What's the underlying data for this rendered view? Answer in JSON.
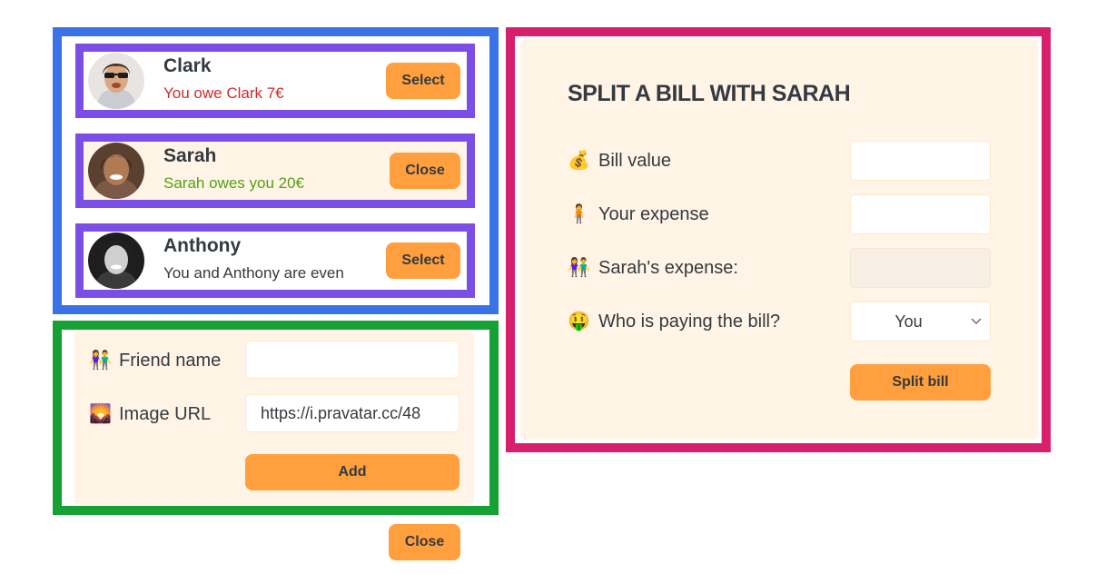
{
  "friends": [
    {
      "name": "Clark",
      "status": "You owe Clark 7€",
      "status_type": "red",
      "button": "Select"
    },
    {
      "name": "Sarah",
      "status": "Sarah owes you 20€",
      "status_type": "green",
      "button": "Close"
    },
    {
      "name": "Anthony",
      "status": "You and Anthony are even",
      "status_type": "neutral",
      "button": "Select"
    }
  ],
  "add_friend": {
    "name_emoji": "👫",
    "name_label": "Friend name",
    "name_value": "",
    "image_emoji": "🌄",
    "image_label": "Image URL",
    "image_value": "https://i.pravatar.cc/48",
    "add_button": "Add"
  },
  "close_button": "Close",
  "split": {
    "title": "SPLIT A BILL WITH SARAH",
    "bill_emoji": "💰",
    "bill_label": "Bill value",
    "bill_value": "",
    "your_emoji": "🧍",
    "your_label": "Your expense",
    "your_value": "",
    "friend_emoji": "👫",
    "friend_label": "Sarah's expense:",
    "friend_value": "",
    "payer_emoji": "🤑",
    "payer_label": "Who is paying the bill?",
    "payer_value": "You",
    "split_button": "Split bill"
  },
  "colors": {
    "accent": "#ff9f3d",
    "panel": "#fff4e6",
    "owe_red": "#d12a2a",
    "owed_green": "#52a117",
    "frame_blue": "#3b72e8",
    "frame_purple": "#7b4fe6",
    "frame_green": "#16a135",
    "frame_pink": "#d81f6b"
  }
}
